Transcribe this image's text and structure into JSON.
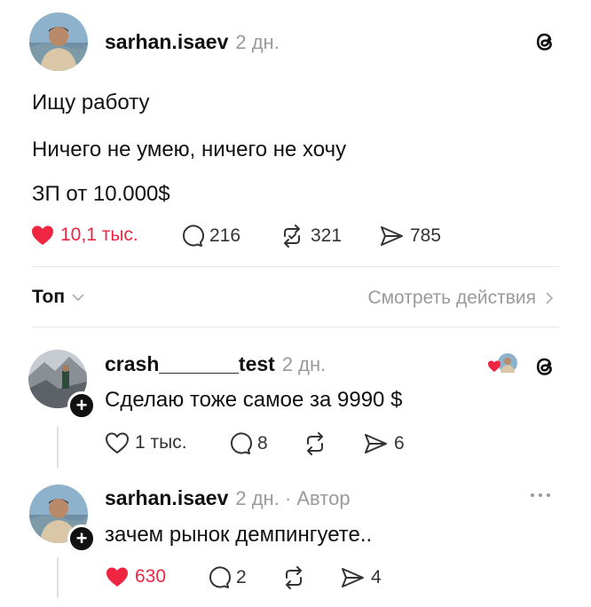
{
  "post": {
    "username": "sarhan.isaev",
    "time": "2 дн.",
    "lines": [
      "Ищу работу",
      "Ничего не умею, ничего не хочу",
      "ЗП от 10.000$"
    ],
    "likes": "10,1 тыс.",
    "comments": "216",
    "reposts": "321",
    "shares": "785"
  },
  "replies_bar": {
    "sort_label": "Топ",
    "activity_link": "Смотреть действия"
  },
  "comments": [
    {
      "username": "crash_______test",
      "time": "2 дн.",
      "text": "Сделаю тоже самое за 9990 $",
      "likes": "1 тыс.",
      "comments": "8",
      "shares": "6"
    },
    {
      "username": "sarhan.isaev",
      "time": "2 дн. · Автор",
      "text": "зачем рынок демпингуете..",
      "likes": "630",
      "comments": "2",
      "shares": "4"
    }
  ],
  "colors": {
    "like_red": "#ee2642",
    "muted": "#9a9a9a"
  }
}
